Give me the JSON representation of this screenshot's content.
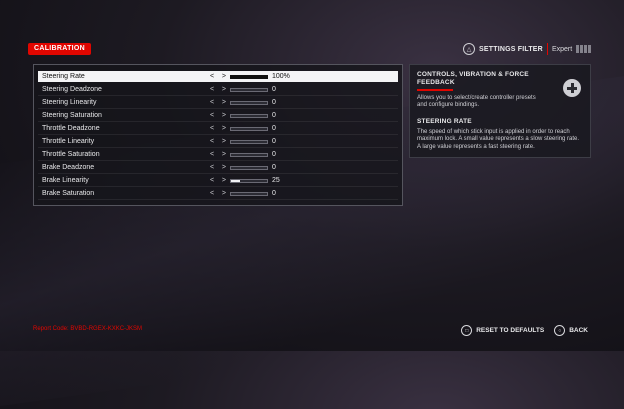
{
  "header": {
    "title": "CALIBRATION",
    "filter_label": "SETTINGS FILTER",
    "filter_value": "Expert"
  },
  "settings": [
    {
      "label": "Steering Rate",
      "value": "100%",
      "level": 1.0,
      "selected": true
    },
    {
      "label": "Steering Deadzone",
      "value": "0",
      "level": 0.0
    },
    {
      "label": "Steering Linearity",
      "value": "0",
      "level": 0.0
    },
    {
      "label": "Steering Saturation",
      "value": "0",
      "level": 0.0
    },
    {
      "label": "Throttle Deadzone",
      "value": "0",
      "level": 0.0
    },
    {
      "label": "Throttle Linearity",
      "value": "0",
      "level": 0.0
    },
    {
      "label": "Throttle Saturation",
      "value": "0",
      "level": 0.0
    },
    {
      "label": "Brake Deadzone",
      "value": "0",
      "level": 0.0
    },
    {
      "label": "Brake Linearity",
      "value": "25",
      "level": 0.25
    },
    {
      "label": "Brake Saturation",
      "value": "0",
      "level": 0.0
    }
  ],
  "info": {
    "section_title": "CONTROLS, VIBRATION & FORCE FEEDBACK",
    "section_desc": "Allows you to select/create controller presets and configure bindings.",
    "item_title": "STEERING RATE",
    "item_desc": "The speed of which stick input is applied in order to reach maximum lock. A small value represents a slow steering rate. A large value represents a fast steering rate.",
    "icon": "dpad-icon"
  },
  "footer": {
    "report_code": "Report Code: BVBD-RGEX-KXKC-JKSM",
    "reset_label": "RESET TO DEFAULTS",
    "back_label": "BACK"
  },
  "colors": {
    "accent": "#e10600"
  }
}
